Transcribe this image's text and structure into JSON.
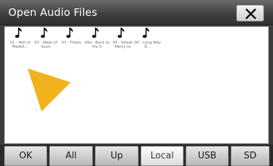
{
  "window": {
    "title": "Open Audio Files",
    "close_icon": "close-x-icon"
  },
  "files": [
    {
      "icon": "music-note-icon",
      "name": "01 - Hell of Madell..."
    },
    {
      "icon": "music-note-icon",
      "name": "03 - Wear of Soulr"
    },
    {
      "icon": "music-note-icon",
      "name": "03 - Floats"
    },
    {
      "icon": "music-note-icon",
      "name": "04a - Back to the S"
    },
    {
      "icon": "music-note-icon",
      "name": "05 - Streat Mercy to"
    },
    {
      "icon": "music-note-icon",
      "name": "06 - Long Way D..."
    }
  ],
  "pointer": {
    "icon": "pointer-arrow-icon",
    "color": "#f2b21b"
  },
  "toolbar": {
    "buttons": [
      {
        "label": "OK",
        "active": false
      },
      {
        "label": "All",
        "active": false
      },
      {
        "label": "Up",
        "active": false
      },
      {
        "label": "Local",
        "active": true
      },
      {
        "label": "USB",
        "active": false
      },
      {
        "label": "SD",
        "active": false
      }
    ]
  },
  "colors": {
    "title_bar": "#3e3e3e",
    "pane_background": "#ffffff",
    "pointer": "#f2b21b"
  }
}
